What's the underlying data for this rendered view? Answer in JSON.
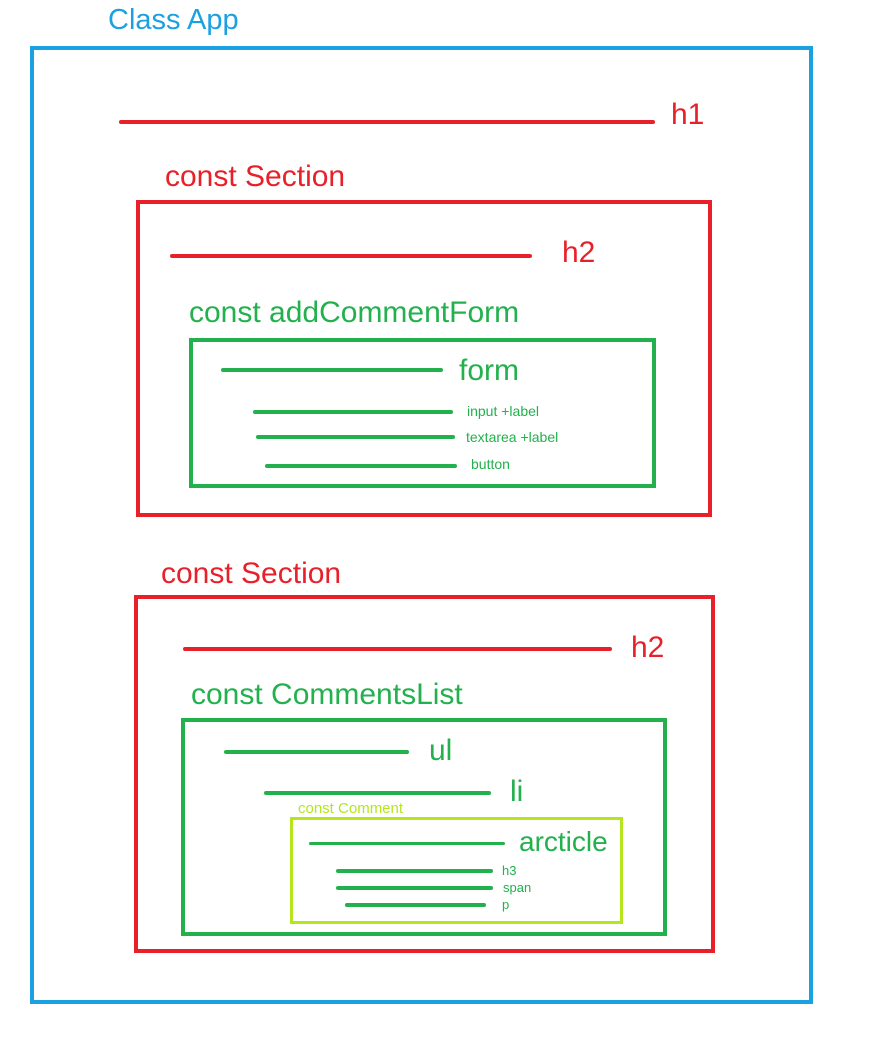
{
  "colors": {
    "app": "#1ba1e2",
    "section": "#e8202a",
    "component": "#22b14c",
    "comment": "#b5e61d"
  },
  "app": {
    "label": "Class App",
    "h1_label": "h1"
  },
  "section1": {
    "label": "const Section",
    "h2_label": "h2",
    "form_component": {
      "label": "const addCommentForm",
      "form_label": "form",
      "input_label": "input  +label",
      "textarea_label": "textarea  +label",
      "button_label": "button"
    }
  },
  "section2": {
    "label": "const Section",
    "h2_label": "h2",
    "list_component": {
      "label": "const CommentsList",
      "ul_label": "ul",
      "li_label": "li",
      "comment": {
        "label": "const Comment",
        "article_label": "arcticle",
        "h3_label": "h3",
        "span_label": "span",
        "p_label": "p"
      }
    }
  }
}
